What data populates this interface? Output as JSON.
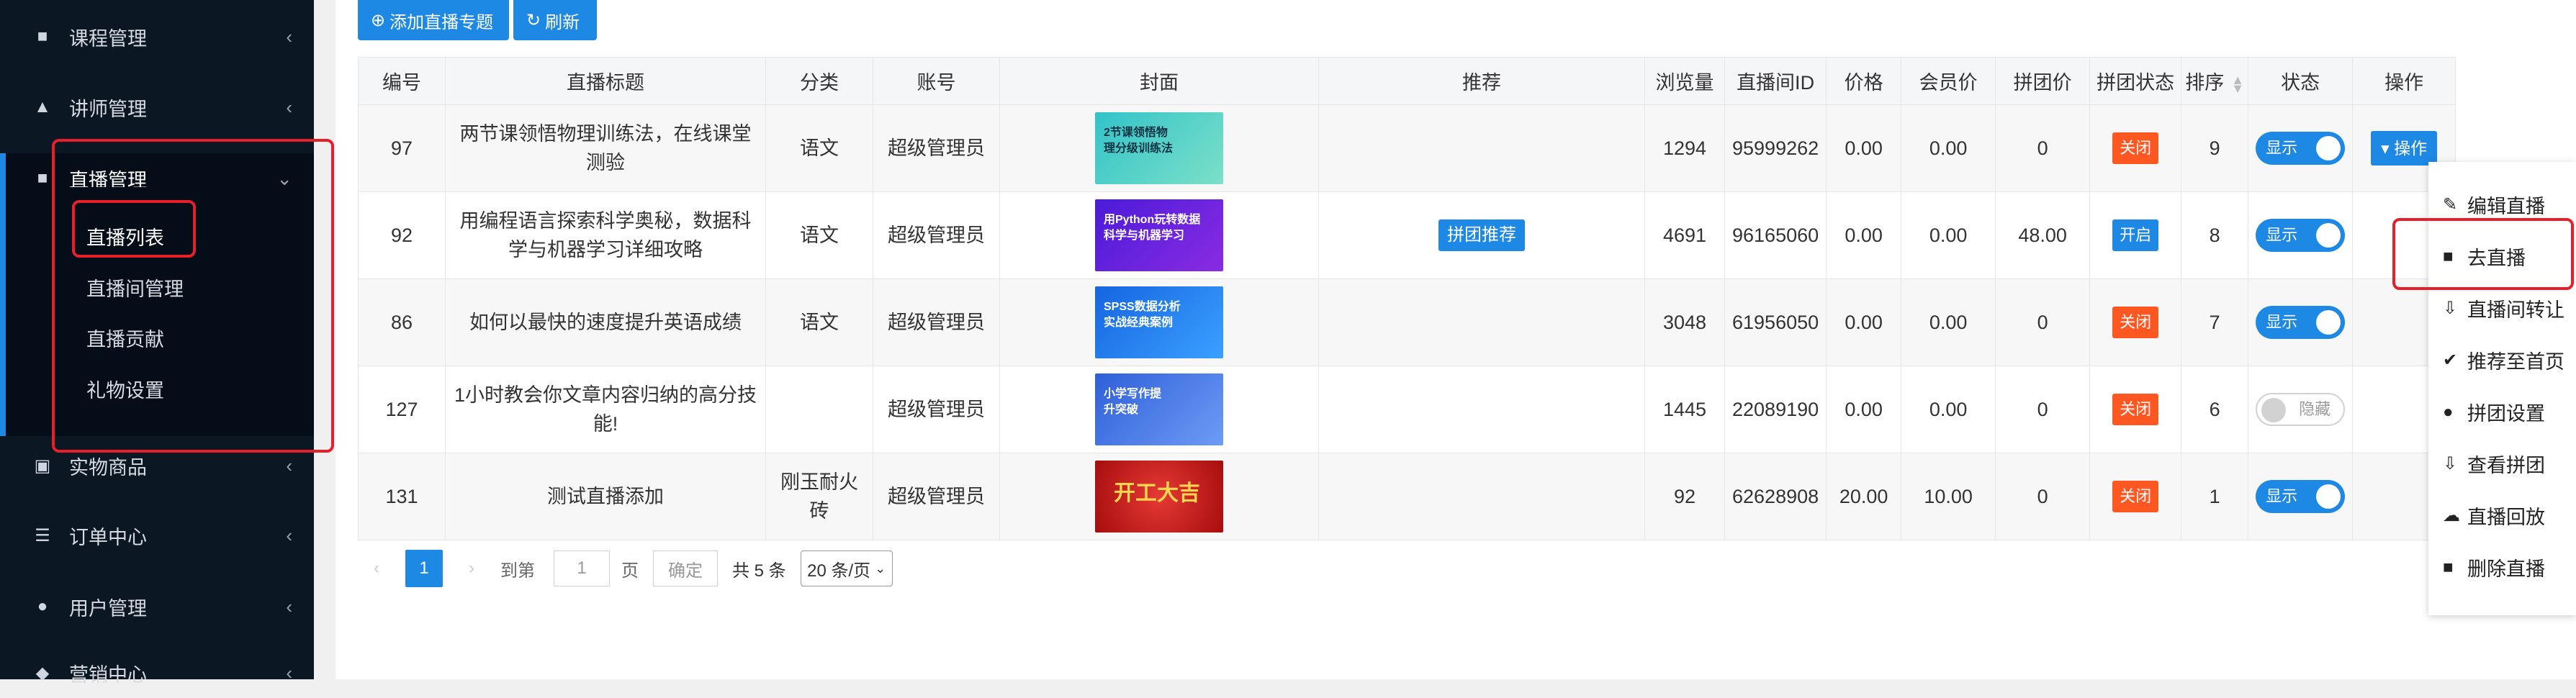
{
  "sidebar": {
    "items": [
      {
        "label": "课程管理",
        "icon": "book-icon"
      },
      {
        "label": "讲师管理",
        "icon": "graduation-cap-icon"
      },
      {
        "label": "直播管理",
        "icon": "video-camera-icon"
      },
      {
        "label": "实物商品",
        "icon": "cart-icon"
      },
      {
        "label": "订单中心",
        "icon": "list-icon"
      },
      {
        "label": "用户管理",
        "icon": "user-icon"
      },
      {
        "label": "营销中心",
        "icon": "marketing-icon"
      }
    ],
    "sub_items": [
      "直播列表",
      "直播间管理",
      "直播贡献",
      "礼物设置"
    ]
  },
  "toolbar": {
    "add_label": "添加直播专题",
    "refresh_label": "刷新"
  },
  "table": {
    "headers": [
      "编号",
      "直播标题",
      "分类",
      "账号",
      "封面",
      "推荐",
      "浏览量",
      "直播间ID",
      "价格",
      "会员价",
      "拼团价",
      "拼团状态",
      "排序",
      "状态",
      "操作"
    ],
    "rows": [
      {
        "id": "97",
        "title": "两节课领悟物理训练法，在线课堂测验",
        "category": "语文",
        "account": "超级管理员",
        "cover_text": "2节课领悟物理分级训练法",
        "recommend": "",
        "views": "1294",
        "room_id": "95999262",
        "price": "0.00",
        "member_price": "0.00",
        "group_price": "0",
        "group_status": "关闭",
        "sort": "9",
        "state": "显示",
        "op": "操作"
      },
      {
        "id": "92",
        "title": "用编程语言探索科学奥秘，数据科学与机器学习详细攻略",
        "category": "语文",
        "account": "超级管理员",
        "cover_text": "用Python玩转数据科学与机器学习",
        "recommend": "拼团推荐",
        "views": "4691",
        "room_id": "96165060",
        "price": "0.00",
        "member_price": "0.00",
        "group_price": "48.00",
        "group_status": "开启",
        "sort": "8",
        "state": "显示",
        "op": ""
      },
      {
        "id": "86",
        "title": "如何以最快的速度提升英语成绩",
        "category": "语文",
        "account": "超级管理员",
        "cover_text": "SPSS数据分析实战经典案例",
        "recommend": "",
        "views": "3048",
        "room_id": "61956050",
        "price": "0.00",
        "member_price": "0.00",
        "group_price": "0",
        "group_status": "关闭",
        "sort": "7",
        "state": "显示",
        "op": ""
      },
      {
        "id": "127",
        "title": "1小时教会你文章内容归纳的高分技能!",
        "category": "",
        "account": "超级管理员",
        "cover_text": "小学写作提升突破",
        "recommend": "",
        "views": "1445",
        "room_id": "22089190",
        "price": "0.00",
        "member_price": "0.00",
        "group_price": "0",
        "group_status": "关闭",
        "sort": "6",
        "state": "隐藏",
        "op": ""
      },
      {
        "id": "131",
        "title": "测试直播添加",
        "category": "刚玉耐火砖",
        "account": "超级管理员",
        "cover_text": "开工大吉",
        "recommend": "",
        "views": "92",
        "room_id": "62628908",
        "price": "20.00",
        "member_price": "10.00",
        "group_price": "0",
        "group_status": "关闭",
        "sort": "1",
        "state": "显示",
        "op": ""
      }
    ]
  },
  "pagination": {
    "current": "1",
    "goto_label": "到第",
    "page_input": "1",
    "page_suffix": "页",
    "confirm": "确定",
    "total": "共 5 条",
    "per_page": "20 条/页"
  },
  "dropdown": {
    "items": [
      {
        "label": "编辑直播",
        "icon": "edit-icon"
      },
      {
        "label": "去直播",
        "icon": "video-camera-icon"
      },
      {
        "label": "直播间转让",
        "icon": "transfer-icon"
      },
      {
        "label": "推荐至首页",
        "icon": "check-circle-icon"
      },
      {
        "label": "拼团设置",
        "icon": "users-icon"
      },
      {
        "label": "查看拼团",
        "icon": "download-icon"
      },
      {
        "label": "直播回放",
        "icon": "cloud-download-icon"
      },
      {
        "label": "删除直播",
        "icon": "trash-icon"
      }
    ]
  },
  "colors": {
    "accent": "#1e88e5",
    "sidebar_bg": "#0c1724",
    "off_badge": "#ff5722",
    "highlight": "#e5202b"
  }
}
